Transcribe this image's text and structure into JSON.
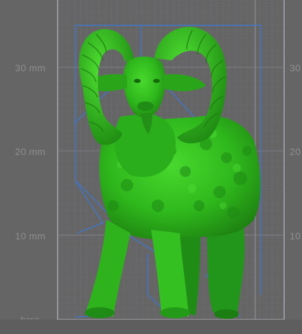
{
  "viewer": {
    "ruler_labels_left": [
      "30 mm",
      "20 mm",
      "10 mm",
      "base"
    ],
    "ruler_labels_right": [
      "30",
      "20",
      "10"
    ],
    "model": {
      "name": "ram",
      "color": "#2fbf1a"
    },
    "colors": {
      "background": "#656565",
      "build_volume_line": "#b8b8c8",
      "support_line": "#3c7cd6",
      "grid": "#7a7a86"
    }
  }
}
